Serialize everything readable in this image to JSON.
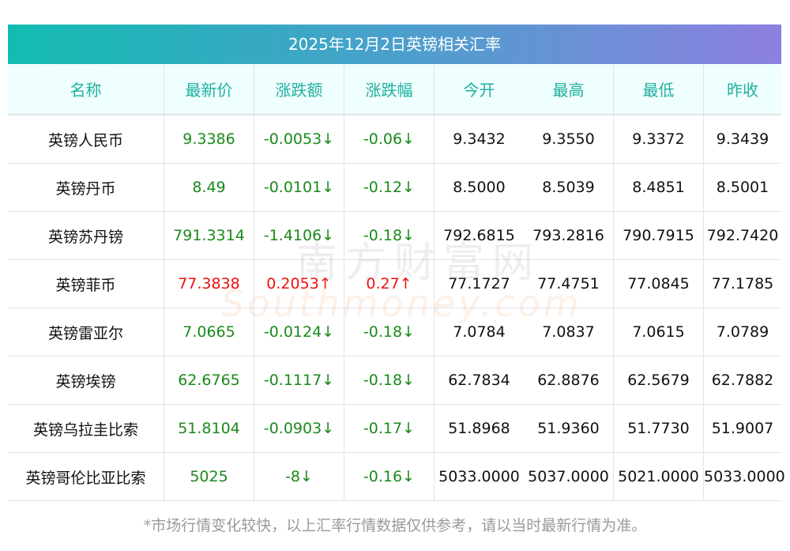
{
  "title": "2025年12月2日英镑相关汇率",
  "headers": [
    "名称",
    "最新价",
    "涨跌额",
    "涨跌幅",
    "今开",
    "最高",
    "最低",
    "昨收"
  ],
  "rows": [
    {
      "name": "英镑人民币",
      "latest": "9.3386",
      "change": "-0.0053↓",
      "pct": "-0.06↓",
      "open": "9.3432",
      "high": "9.3550",
      "low": "9.3372",
      "prev": "9.3439",
      "dir": "down"
    },
    {
      "name": "英镑丹币",
      "latest": "8.49",
      "change": "-0.0101↓",
      "pct": "-0.12↓",
      "open": "8.5000",
      "high": "8.5039",
      "low": "8.4851",
      "prev": "8.5001",
      "dir": "down"
    },
    {
      "name": "英镑苏丹镑",
      "latest": "791.3314",
      "change": "-1.4106↓",
      "pct": "-0.18↓",
      "open": "792.6815",
      "high": "793.2816",
      "low": "790.7915",
      "prev": "792.7420",
      "dir": "down"
    },
    {
      "name": "英镑菲币",
      "latest": "77.3838",
      "change": "0.2053↑",
      "pct": "0.27↑",
      "open": "77.1727",
      "high": "77.4751",
      "low": "77.0845",
      "prev": "77.1785",
      "dir": "up"
    },
    {
      "name": "英镑雷亚尔",
      "latest": "7.0665",
      "change": "-0.0124↓",
      "pct": "-0.18↓",
      "open": "7.0784",
      "high": "7.0837",
      "low": "7.0615",
      "prev": "7.0789",
      "dir": "down"
    },
    {
      "name": "英镑埃镑",
      "latest": "62.6765",
      "change": "-0.1117↓",
      "pct": "-0.18↓",
      "open": "62.7834",
      "high": "62.8876",
      "low": "62.5679",
      "prev": "62.7882",
      "dir": "down"
    },
    {
      "name": "英镑乌拉圭比索",
      "latest": "51.8104",
      "change": "-0.0903↓",
      "pct": "-0.17↓",
      "open": "51.8968",
      "high": "51.9360",
      "low": "51.7730",
      "prev": "51.9007",
      "dir": "down"
    },
    {
      "name": "英镑哥伦比亚比索",
      "latest": "5025",
      "change": "-8↓",
      "pct": "-0.16↓",
      "open": "5033.0000",
      "high": "5037.0000",
      "low": "5021.0000",
      "prev": "5033.0000",
      "dir": "down"
    }
  ],
  "watermark": {
    "cn": "南方财富网",
    "en": "Southmoney.com"
  },
  "note": "*市场行情变化较快，以上汇率行情数据仅供参考，请以当时最新行情为准。",
  "colors": {
    "up": "#f01010",
    "down": "#1a8a1a"
  }
}
